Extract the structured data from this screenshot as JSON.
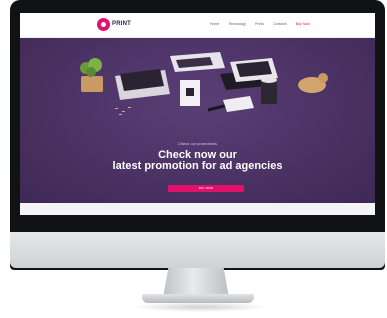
{
  "site": {
    "logo_text": "PRINT",
    "nav": [
      {
        "label": "Home"
      },
      {
        "label": "Technology"
      },
      {
        "label": "Prints"
      },
      {
        "label": "Contacts"
      },
      {
        "label": "Buy Now"
      }
    ]
  },
  "hero": {
    "kicker": "Check our promotions",
    "title_line1": "Check now our",
    "title_line2": "latest promotion for ad agencies",
    "button_label": "BUY NOW"
  },
  "colors": {
    "accent": "#e0116b",
    "hero_bg": "#4a3163",
    "frame": "#111214"
  }
}
